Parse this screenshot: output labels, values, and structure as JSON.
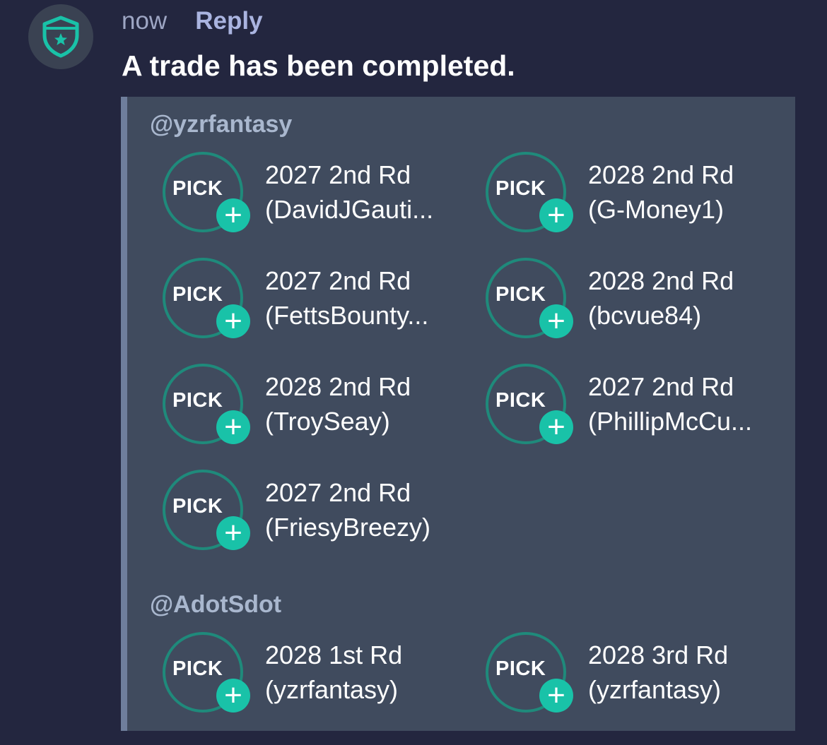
{
  "message": {
    "timestamp": "now",
    "reply_label": "Reply",
    "text": "A trade has been completed.",
    "avatar_icon": "shield-star-icon",
    "accent_color": "#19c2a8"
  },
  "trade": {
    "sides": [
      {
        "owner": "@yzrfantasy",
        "picks": [
          {
            "badge": "PICK",
            "line1": "2027 2nd Rd",
            "line2": "(DavidJGauti..."
          },
          {
            "badge": "PICK",
            "line1": "2028 2nd Rd",
            "line2": "(G-Money1)"
          },
          {
            "badge": "PICK",
            "line1": "2027 2nd Rd",
            "line2": "(FettsBounty..."
          },
          {
            "badge": "PICK",
            "line1": "2028 2nd Rd",
            "line2": "(bcvue84)"
          },
          {
            "badge": "PICK",
            "line1": "2028 2nd Rd",
            "line2": "(TroySeay)"
          },
          {
            "badge": "PICK",
            "line1": "2027 2nd Rd",
            "line2": "(PhillipMcCu..."
          },
          {
            "badge": "PICK",
            "line1": "2027 2nd Rd",
            "line2": "(FriesyBreezy)"
          }
        ]
      },
      {
        "owner": "@AdotSdot",
        "picks": [
          {
            "badge": "PICK",
            "line1": "2028 1st Rd",
            "line2": "(yzrfantasy)"
          },
          {
            "badge": "PICK",
            "line1": "2028 3rd Rd",
            "line2": "(yzrfantasy)"
          }
        ]
      }
    ]
  }
}
